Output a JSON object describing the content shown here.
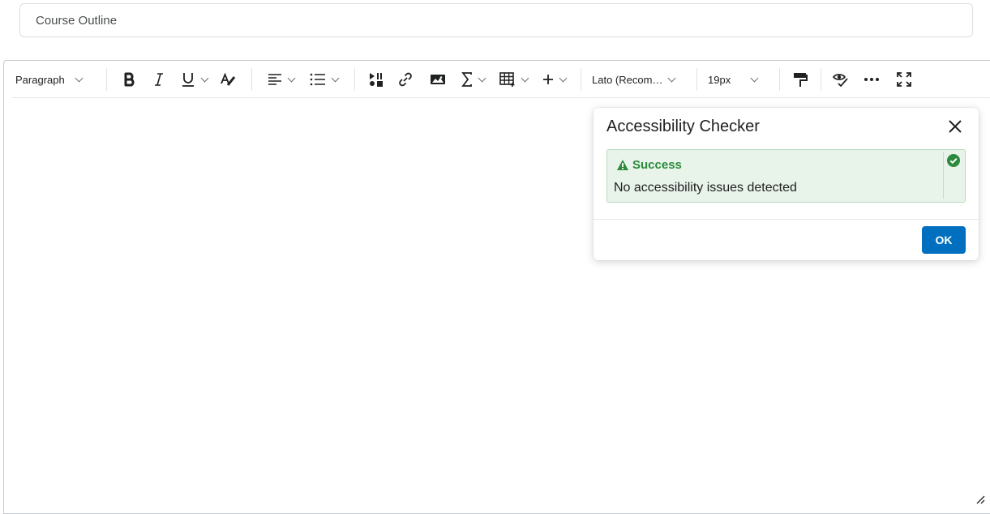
{
  "title_field": {
    "value": "Course Outline"
  },
  "toolbar": {
    "block_format": "Paragraph",
    "font_family": "Lato (Recom…",
    "font_size": "19px"
  },
  "dialog": {
    "title": "Accessibility Checker",
    "alert_title": "Success",
    "alert_message": "No accessibility issues detected",
    "ok_label": "OK"
  },
  "colors": {
    "primary": "#006fbf",
    "success": "#2c8a3c",
    "success_bg": "#e8f3ea"
  }
}
